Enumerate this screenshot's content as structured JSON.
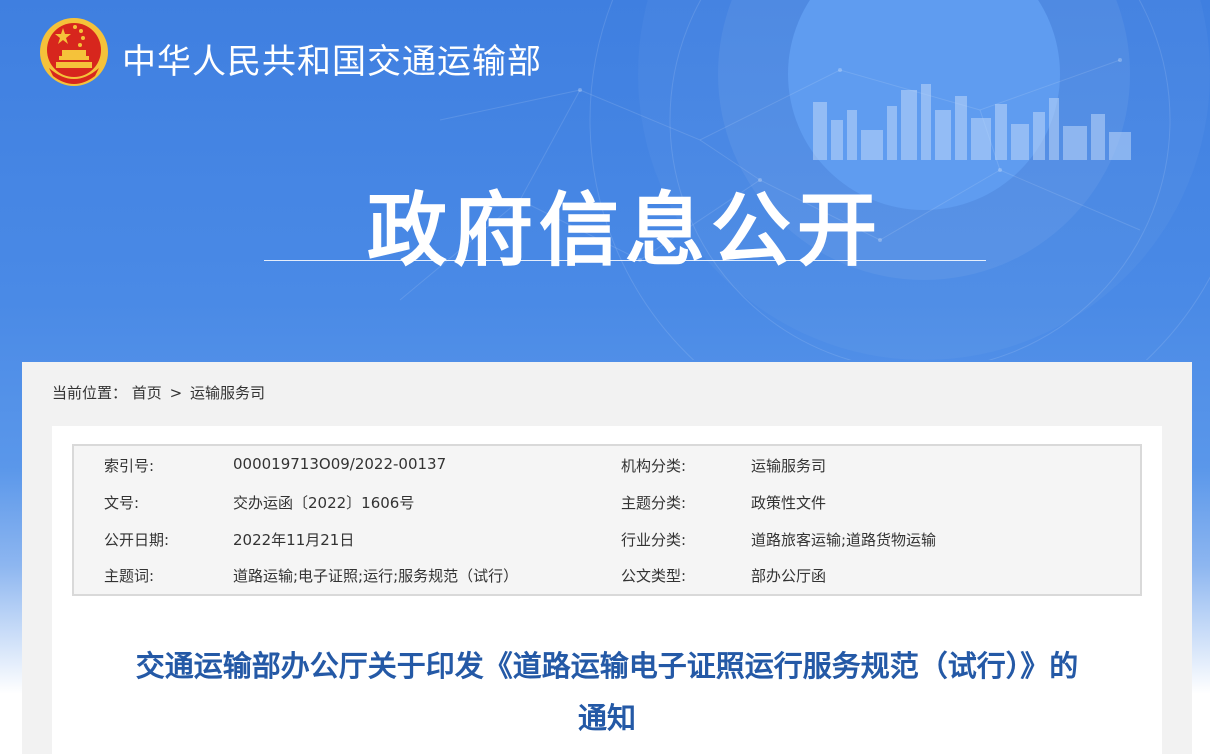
{
  "header": {
    "ministry_name": "中华人民共和国交通运输部",
    "page_title": "政府信息公开"
  },
  "breadcrumb": {
    "label": "当前位置：",
    "home": "首页",
    "separator": ">",
    "current": "运输服务司"
  },
  "meta": {
    "rows": [
      {
        "k1": "索引号:",
        "v1": "000019713O09/2022-00137",
        "k2": "机构分类:",
        "v2": "运输服务司"
      },
      {
        "k1": "文号:",
        "v1": "交办运函〔2022〕1606号",
        "k2": "主题分类:",
        "v2": "政策性文件"
      },
      {
        "k1": "公开日期:",
        "v1": "2022年11月21日",
        "k2": "行业分类:",
        "v2": "道路旅客运输;道路货物运输"
      },
      {
        "k1": "主题词:",
        "v1": "道路运输;电子证照;运行;服务规范（试行）",
        "k2": "公文类型:",
        "v2": "部办公厅函"
      }
    ]
  },
  "document": {
    "title_line1": "交通运输部办公厅关于印发《道路运输电子证照运行服务规范（试行）》的",
    "title_line2": "通知"
  },
  "colors": {
    "header_blue": "#3f7fe0",
    "title_blue": "#2459a6",
    "emblem_red": "#d7261d",
    "emblem_gold": "#f5c23a"
  },
  "icons": {
    "emblem": "national-emblem-icon"
  }
}
